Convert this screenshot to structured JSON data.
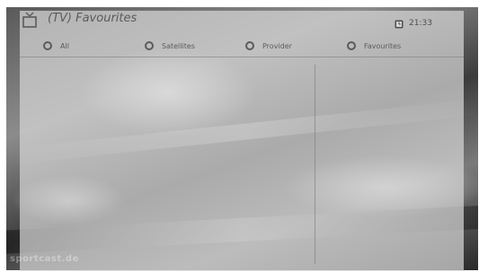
{
  "header": {
    "title": "(TV) Favourites",
    "time": "21:33",
    "icons": {
      "title": "tv-icon",
      "time": "clock-icon"
    }
  },
  "tabs": [
    {
      "label": "All"
    },
    {
      "label": "Satellites"
    },
    {
      "label": "Provider"
    },
    {
      "label": "Favourites"
    }
  ],
  "watermark": "sportcast.de",
  "colors": {
    "panel": "#d6d6d6",
    "text": "#5b5b5b",
    "frame": "#1a1a1a"
  }
}
